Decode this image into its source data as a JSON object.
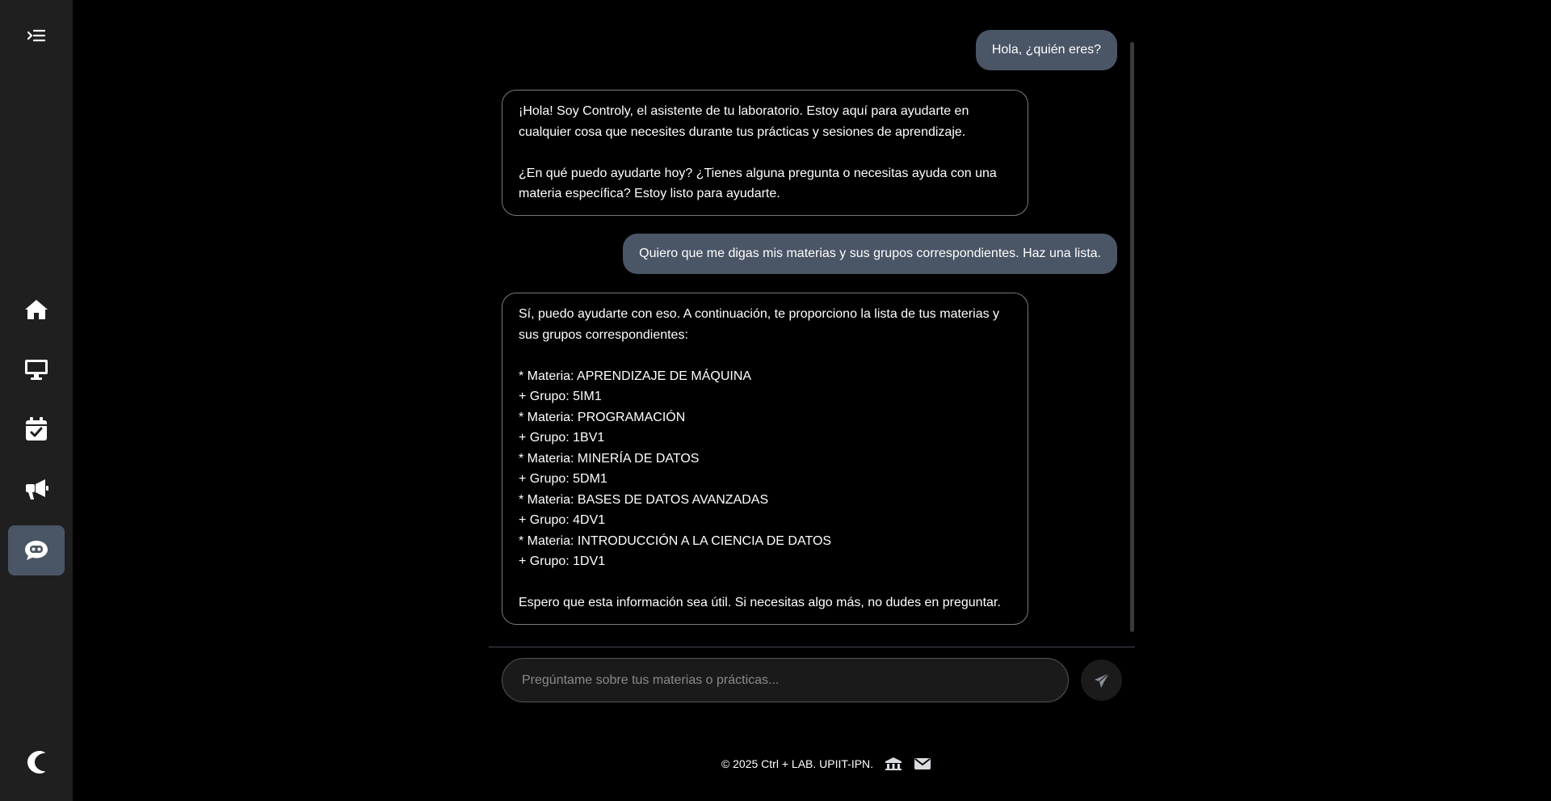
{
  "sidebar": {
    "items": [
      {
        "icon": "menu-toggle-icon"
      },
      {
        "icon": "home-icon"
      },
      {
        "icon": "desktop-icon"
      },
      {
        "icon": "calendar-check-icon"
      },
      {
        "icon": "megaphone-icon"
      },
      {
        "icon": "chatbot-icon",
        "active": true
      },
      {
        "icon": "moon-icon"
      }
    ]
  },
  "chat": {
    "messages": [
      {
        "role": "user",
        "text": "Hola, ¿quién eres?"
      },
      {
        "role": "bot",
        "text": "¡Hola! Soy Controly, el asistente de tu laboratorio. Estoy aquí para ayudarte en cualquier cosa que necesites durante tus prácticas y sesiones de aprendizaje.\n\n¿En qué puedo ayudarte hoy? ¿Tienes alguna pregunta o necesitas ayuda con una materia específica? Estoy listo para ayudarte."
      },
      {
        "role": "user",
        "text": "Quiero que me digas mis materias y sus grupos correspondientes. Haz una lista."
      },
      {
        "role": "bot",
        "text": "Sí, puedo ayudarte con eso. A continuación, te proporciono la lista de tus materias y sus grupos correspondientes:\n\n* Materia: APRENDIZAJE DE MÁQUINA\n  + Grupo: 5IM1\n* Materia: PROGRAMACIÓN\n  + Grupo: 1BV1\n* Materia: MINERÍA DE DATOS\n  + Grupo: 5DM1\n* Materia: BASES DE DATOS AVANZADAS\n  + Grupo: 4DV1\n* Materia: INTRODUCCIÓN A LA CIENCIA DE DATOS\n  + Grupo: 1DV1\n\nEspero que esta información sea útil. Si necesitas algo más, no dudes en preguntar."
      }
    ]
  },
  "input": {
    "placeholder": "Pregúntame sobre tus materias o prácticas...",
    "value": ""
  },
  "footer": {
    "copyright": "© 2025 Ctrl + LAB. UPIIT-IPN."
  },
  "colors": {
    "sidebar_bg": "#1f1f1f",
    "accent": "#4a5566",
    "page_bg": "#000000"
  }
}
